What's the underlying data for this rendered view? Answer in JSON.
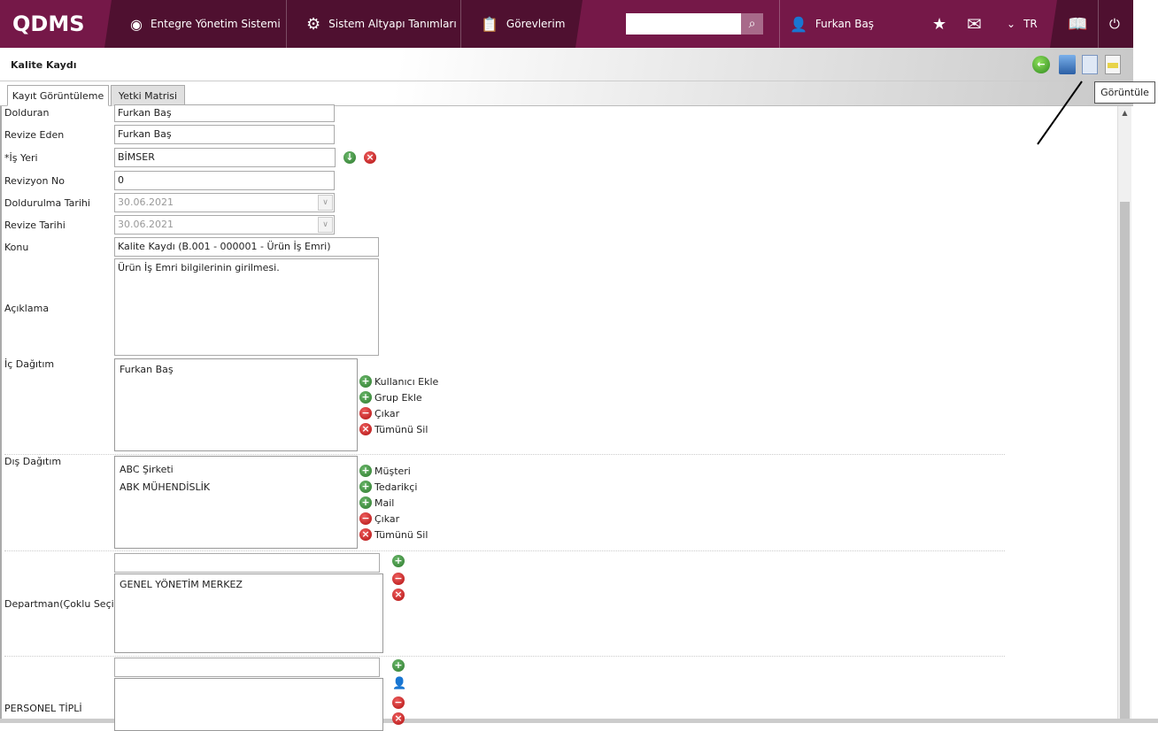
{
  "header": {
    "logo": "QDMS",
    "nav": [
      {
        "label": "Entegre Yönetim Sistemi",
        "icon": "q-icon"
      },
      {
        "label": "Sistem Altyapı Tanımları",
        "icon": "gear-icon"
      },
      {
        "label": "Görevlerim",
        "icon": "clipboard-icon"
      }
    ],
    "search": {
      "value": "",
      "placeholder": ""
    },
    "user": "Furkan Baş",
    "language": "TR"
  },
  "page": {
    "title": "Kalite Kaydı",
    "tooltip": "Görüntüle",
    "tabs": [
      "Kayıt Görüntüleme",
      "Yetki Matrisi"
    ]
  },
  "form": {
    "dolduran": {
      "label": "Dolduran",
      "value": "Furkan Baş"
    },
    "revize_eden": {
      "label": "Revize Eden",
      "value": "Furkan Baş"
    },
    "is_yeri": {
      "label": "*İş Yeri",
      "value": "BİMSER"
    },
    "revizyon_no": {
      "label": "Revizyon No",
      "value": "0"
    },
    "doldurulma_tarihi": {
      "label": "Doldurulma Tarihi",
      "value": "30.06.2021"
    },
    "revize_tarihi": {
      "label": "Revize Tarihi",
      "value": "30.06.2021"
    },
    "konu": {
      "label": "Konu",
      "value": "Kalite Kaydı (B.001 - 000001 - Ürün İş Emri)"
    },
    "aciklama": {
      "label": "Açıklama",
      "value": "Ürün İş Emri bilgilerinin girilmesi."
    },
    "ic_dagitim": {
      "label": "İç Dağıtım",
      "items": [
        "Furkan Baş"
      ],
      "actions": [
        "Kullanıcı Ekle",
        "Grup Ekle",
        "Çıkar",
        "Tümünü Sil"
      ]
    },
    "dis_dagitim": {
      "label": "Dış Dağıtım",
      "items": [
        "ABC Şirketi",
        "ABK MÜHENDİSLİK"
      ],
      "actions": [
        "Müşteri",
        "Tedarikçi",
        "Mail",
        "Çıkar",
        "Tümünü Sil"
      ]
    },
    "departman": {
      "label": "Departman(Çoklu Seçim)",
      "items": [
        "GENEL YÖNETİM MERKEZ"
      ]
    },
    "personel": {
      "label": "PERSONEL TİPLİ"
    }
  }
}
